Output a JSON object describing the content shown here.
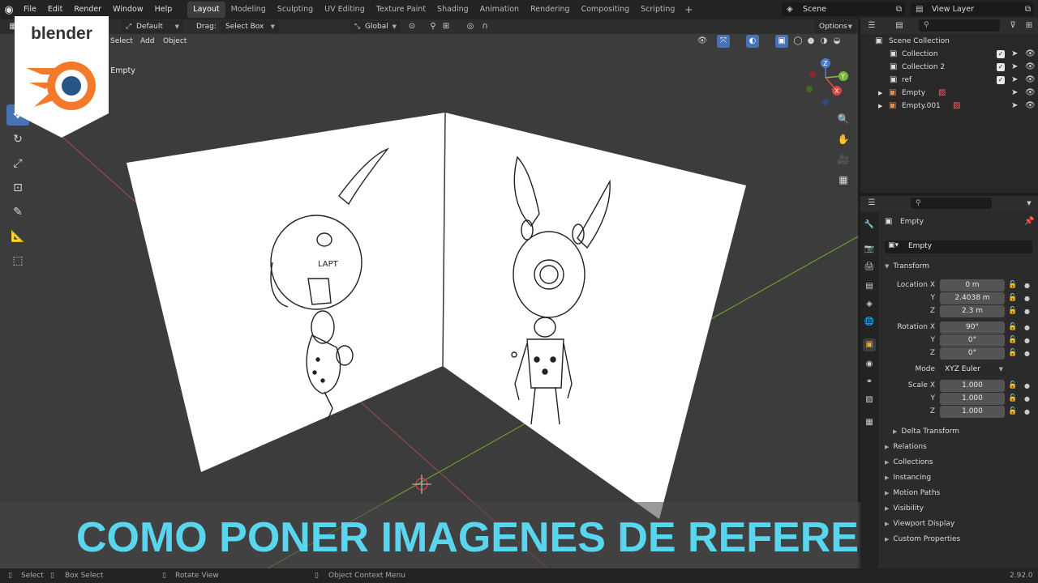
{
  "app": {
    "menus": [
      "File",
      "Edit",
      "Render",
      "Window",
      "Help"
    ],
    "workspaces": [
      "Layout",
      "Modeling",
      "Sculpting",
      "UV Editing",
      "Texture Paint",
      "Shading",
      "Animation",
      "Rendering",
      "Compositing",
      "Scripting"
    ],
    "active_workspace": "Layout",
    "scene": "Scene",
    "view_layer": "View Layer"
  },
  "viewport": {
    "orientation": "Default",
    "drag_label": "Drag:",
    "drag_value": "Select Box",
    "transform_orientation": "Global",
    "options": "Options",
    "menus": [
      "Select",
      "Add",
      "Object"
    ],
    "info_text": "| Empty",
    "gizmo_axes": [
      "Z",
      "Y",
      "X"
    ]
  },
  "logo": {
    "wordmark": "blender",
    "accent_color": "#f5792a",
    "ring_color": "#265787"
  },
  "title_overlay": {
    "text": "COMO PONER IMAGENES DE REFERENCIA",
    "color": "#5ad5ee"
  },
  "outliner": {
    "root": "Scene Collection",
    "items": [
      {
        "name": "Collection"
      },
      {
        "name": "Collection 2"
      },
      {
        "name": "ref"
      },
      {
        "name": "Empty"
      },
      {
        "name": "Empty.001"
      }
    ]
  },
  "properties": {
    "object_name": "Empty",
    "data_name": "Empty",
    "section_transform": "Transform",
    "location_label": "Location X",
    "location": {
      "x": "0 m",
      "y": "2.4038 m",
      "z": "2.3 m"
    },
    "rotation_label": "Rotation X",
    "rotation": {
      "x": "90°",
      "y": "0°",
      "z": "0°"
    },
    "mode_label": "Mode",
    "mode_value": "XYZ Euler",
    "scale_label": "Scale X",
    "scale": {
      "x": "1.000",
      "y": "1.000",
      "z": "1.000"
    },
    "axis_y": "Y",
    "axis_z": "Z",
    "subsections": [
      "Delta Transform",
      "Relations",
      "Collections",
      "Instancing",
      "Motion Paths",
      "Visibility",
      "Viewport Display",
      "Custom Properties"
    ]
  },
  "statusbar": {
    "select": "Select",
    "box_select": "Box Select",
    "rotate_view": "Rotate View",
    "context_menu": "Object Context Menu",
    "version": "2.92.0"
  }
}
